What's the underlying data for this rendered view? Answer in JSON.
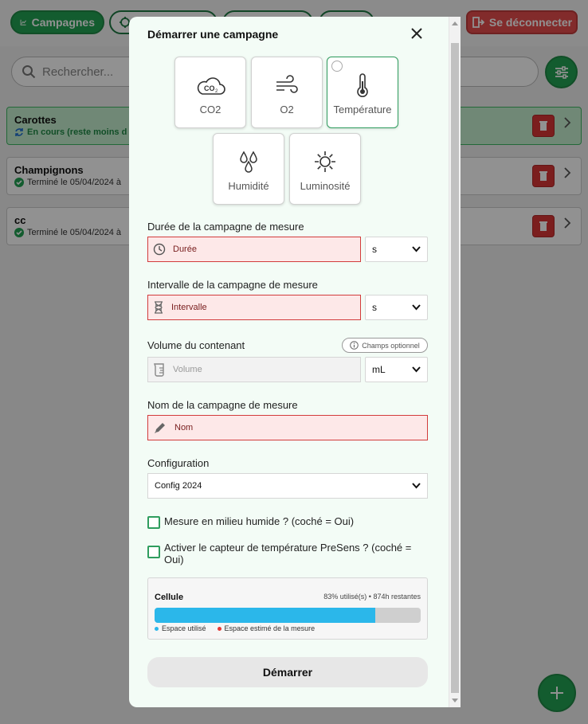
{
  "nav": {
    "campaigns_label": "Campagnes",
    "logout_label": "Se déconnecter"
  },
  "search": {
    "placeholder": "Rechercher..."
  },
  "campaigns": [
    {
      "title": "Carottes",
      "status": "En cours (reste moins d"
    },
    {
      "title": "Champignons",
      "status": "Terminé le 05/04/2024 à"
    },
    {
      "title": "cc",
      "status": "Terminé le 05/04/2024 à"
    }
  ],
  "modal": {
    "title": "Démarrer une campagne",
    "sensors": [
      {
        "label": "CO2",
        "icon": "co2-cloud-icon",
        "selected": false
      },
      {
        "label": "O2",
        "icon": "wind-icon",
        "selected": false
      },
      {
        "label": "Température",
        "icon": "thermometer-icon",
        "selected": true
      },
      {
        "label": "Humidité",
        "icon": "droplets-icon",
        "selected": false
      },
      {
        "label": "Luminosité",
        "icon": "sun-icon",
        "selected": false
      }
    ],
    "duration": {
      "label": "Durée de la campagne de mesure",
      "placeholder": "Durée",
      "unit": "s"
    },
    "interval": {
      "label": "Intervalle de la campagne de mesure",
      "placeholder": "Intervalle",
      "unit": "s"
    },
    "volume": {
      "label": "Volume du contenant",
      "placeholder": "Volume",
      "unit": "mL",
      "optional_badge": "Champs optionnel"
    },
    "name": {
      "label": "Nom de la campagne de mesure",
      "placeholder": "Nom"
    },
    "configuration": {
      "label": "Configuration",
      "value": "Config 2024"
    },
    "humid_checkbox": {
      "label": "Mesure en milieu humide ? (coché = Oui)",
      "checked": false
    },
    "presens_checkbox": {
      "label": "Activer le capteur de température PreSens ? (coché = Oui)",
      "checked": false
    },
    "cell": {
      "title": "Cellule",
      "usage_text": "83% utilisé(s) • 874h restantes",
      "used_fraction": 0.83,
      "legend_used": "Espace utilisé",
      "legend_estimated": "Espace estimé de la mesure"
    },
    "start_label": "Démarrer"
  },
  "colors": {
    "accent_green": "#22a254",
    "danger_red": "#d93636",
    "used_blue": "#2bb7ea",
    "estimate_red": "#e53935"
  }
}
